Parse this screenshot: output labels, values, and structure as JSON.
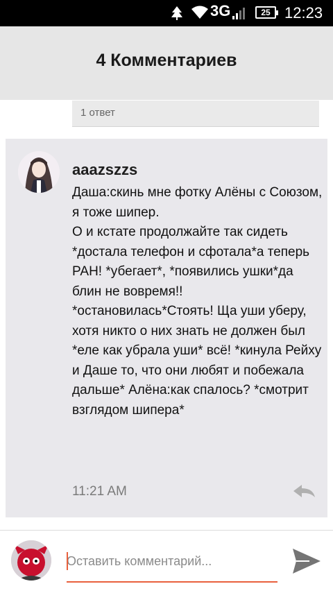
{
  "status_bar": {
    "network": "3G",
    "battery": "25",
    "time": "12:23"
  },
  "header": {
    "title": "4 Комментариев"
  },
  "previous_comment": {
    "replies_label": "1 ответ"
  },
  "comment": {
    "username": "aaazszzs",
    "text": "Даша:скинь мне фотку Алёны с Союзом, я тоже шипер.\nО и кстате продолжайте так сидеть *достала телефон и сфотала*а теперь РАН! *убегает*, *появились ушки*да блин не вовремя!! *остановилась*Стоять! Ща уши уберу, хотя никто о них знать не должен был *еле как убрала уши* всё! *кинула Рейху и Даше то, что они любят и побежала дальше* Алёна:как спалось? *смотрит взглядом шипера*",
    "time": "11:21 AM"
  },
  "input": {
    "placeholder": "Оставить комментарий..."
  },
  "colors": {
    "accent": "#e8603c",
    "header_bg": "#e6e6e6",
    "card_bg": "#e9e8ec"
  },
  "icons": [
    "tree-icon",
    "wifi-icon",
    "signal-icon",
    "battery-icon",
    "reply-icon",
    "send-icon"
  ]
}
